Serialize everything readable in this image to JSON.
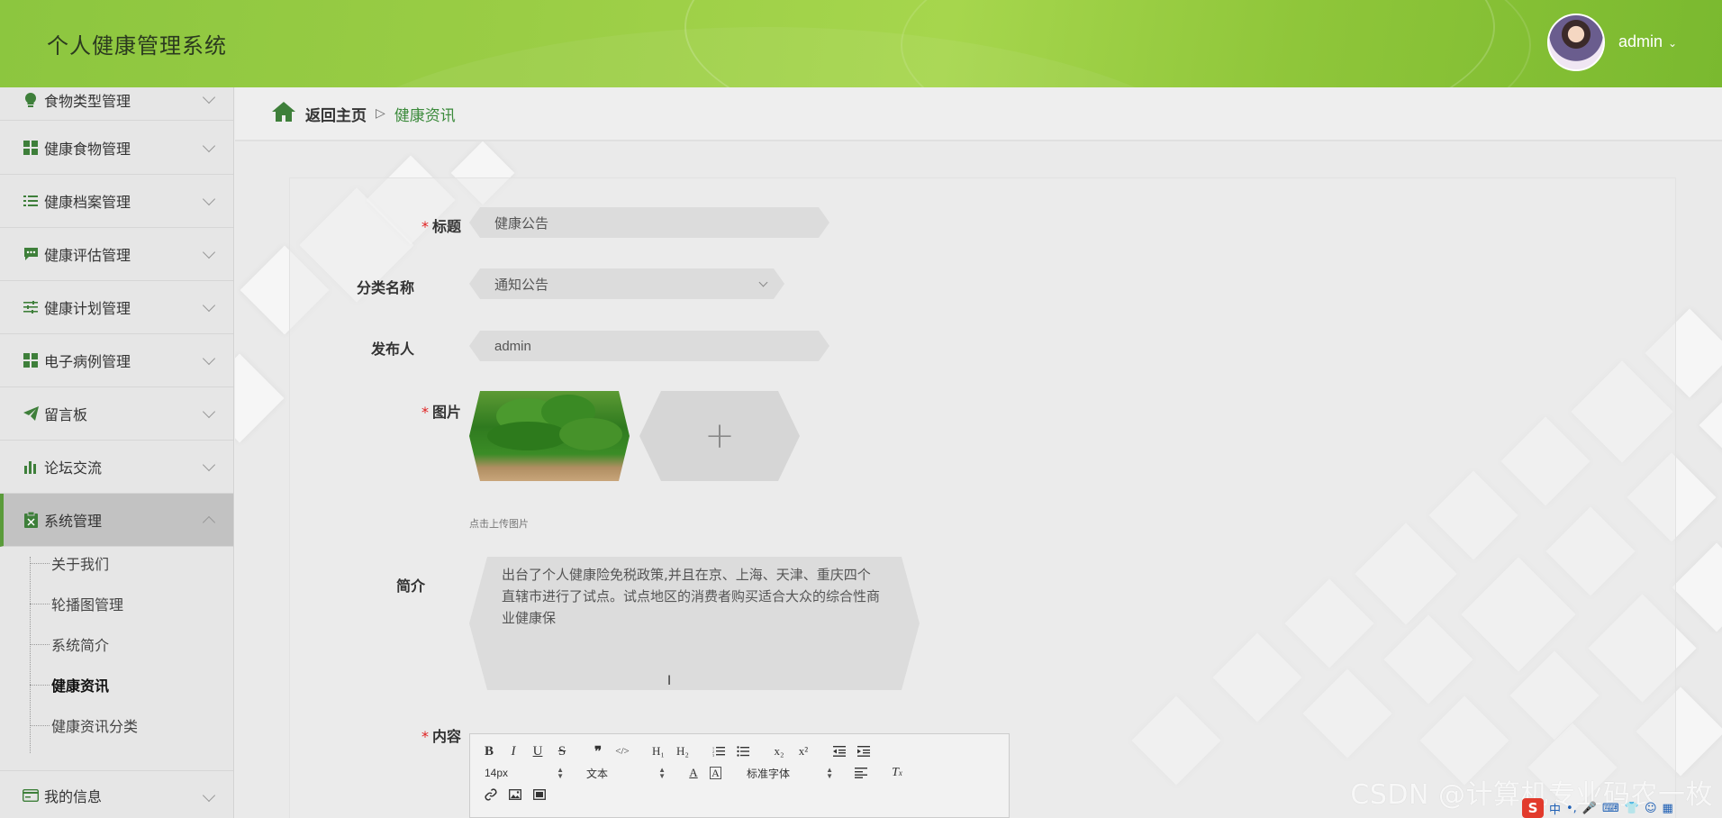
{
  "header": {
    "title": "个人健康管理系统",
    "username": "admin",
    "accent": "#9acd45"
  },
  "sidebar": {
    "items": [
      {
        "label": "食物类型管理",
        "icon": "lightbulb-icon"
      },
      {
        "label": "健康食物管理",
        "icon": "grid-icon"
      },
      {
        "label": "健康档案管理",
        "icon": "list-icon"
      },
      {
        "label": "健康评估管理",
        "icon": "chat-icon"
      },
      {
        "label": "健康计划管理",
        "icon": "sliders-icon"
      },
      {
        "label": "电子病例管理",
        "icon": "grid-icon"
      },
      {
        "label": "留言板",
        "icon": "send-icon"
      },
      {
        "label": "论坛交流",
        "icon": "bar-chart-icon"
      },
      {
        "label": "系统管理",
        "icon": "clipboard-icon"
      },
      {
        "label": "我的信息",
        "icon": "id-card-icon"
      }
    ],
    "submenu": [
      {
        "label": "关于我们"
      },
      {
        "label": "轮播图管理"
      },
      {
        "label": "系统简介"
      },
      {
        "label": "健康资讯"
      },
      {
        "label": "健康资讯分类"
      }
    ]
  },
  "breadcrumb": {
    "home": "返回主页",
    "separator": "▷",
    "current": "健康资讯"
  },
  "form": {
    "title_label": "标题",
    "title_value": "健康公告",
    "category_label": "分类名称",
    "category_value": "通知公告",
    "publisher_label": "发布人",
    "publisher_value": "admin",
    "image_label": "图片",
    "upload_plus": "+",
    "upload_hint": "点击上传图片",
    "summary_label": "简介",
    "summary_value": "出台了个人健康险免税政策,并且在京、上海、天津、重庆四个直辖市进行了试点。试点地区的消费者购买适合大众的综合性商业健康保",
    "content_label": "内容",
    "required_mark": "*"
  },
  "editor": {
    "font_size": "14px",
    "paragraph": "文本",
    "font_family": "标准字体",
    "buttons_row1": [
      "B",
      "I",
      "U",
      "S",
      "❞",
      "</>",
      "H1",
      "H2",
      "ol",
      "ul",
      "x₂",
      "x²",
      "outdent",
      "indent"
    ],
    "buttons_row2_extra": [
      "A",
      "A-bg",
      "align",
      "Tx"
    ]
  },
  "watermark": "CSDN @计算机专业码农一枚",
  "tray": {
    "ime": "中"
  }
}
